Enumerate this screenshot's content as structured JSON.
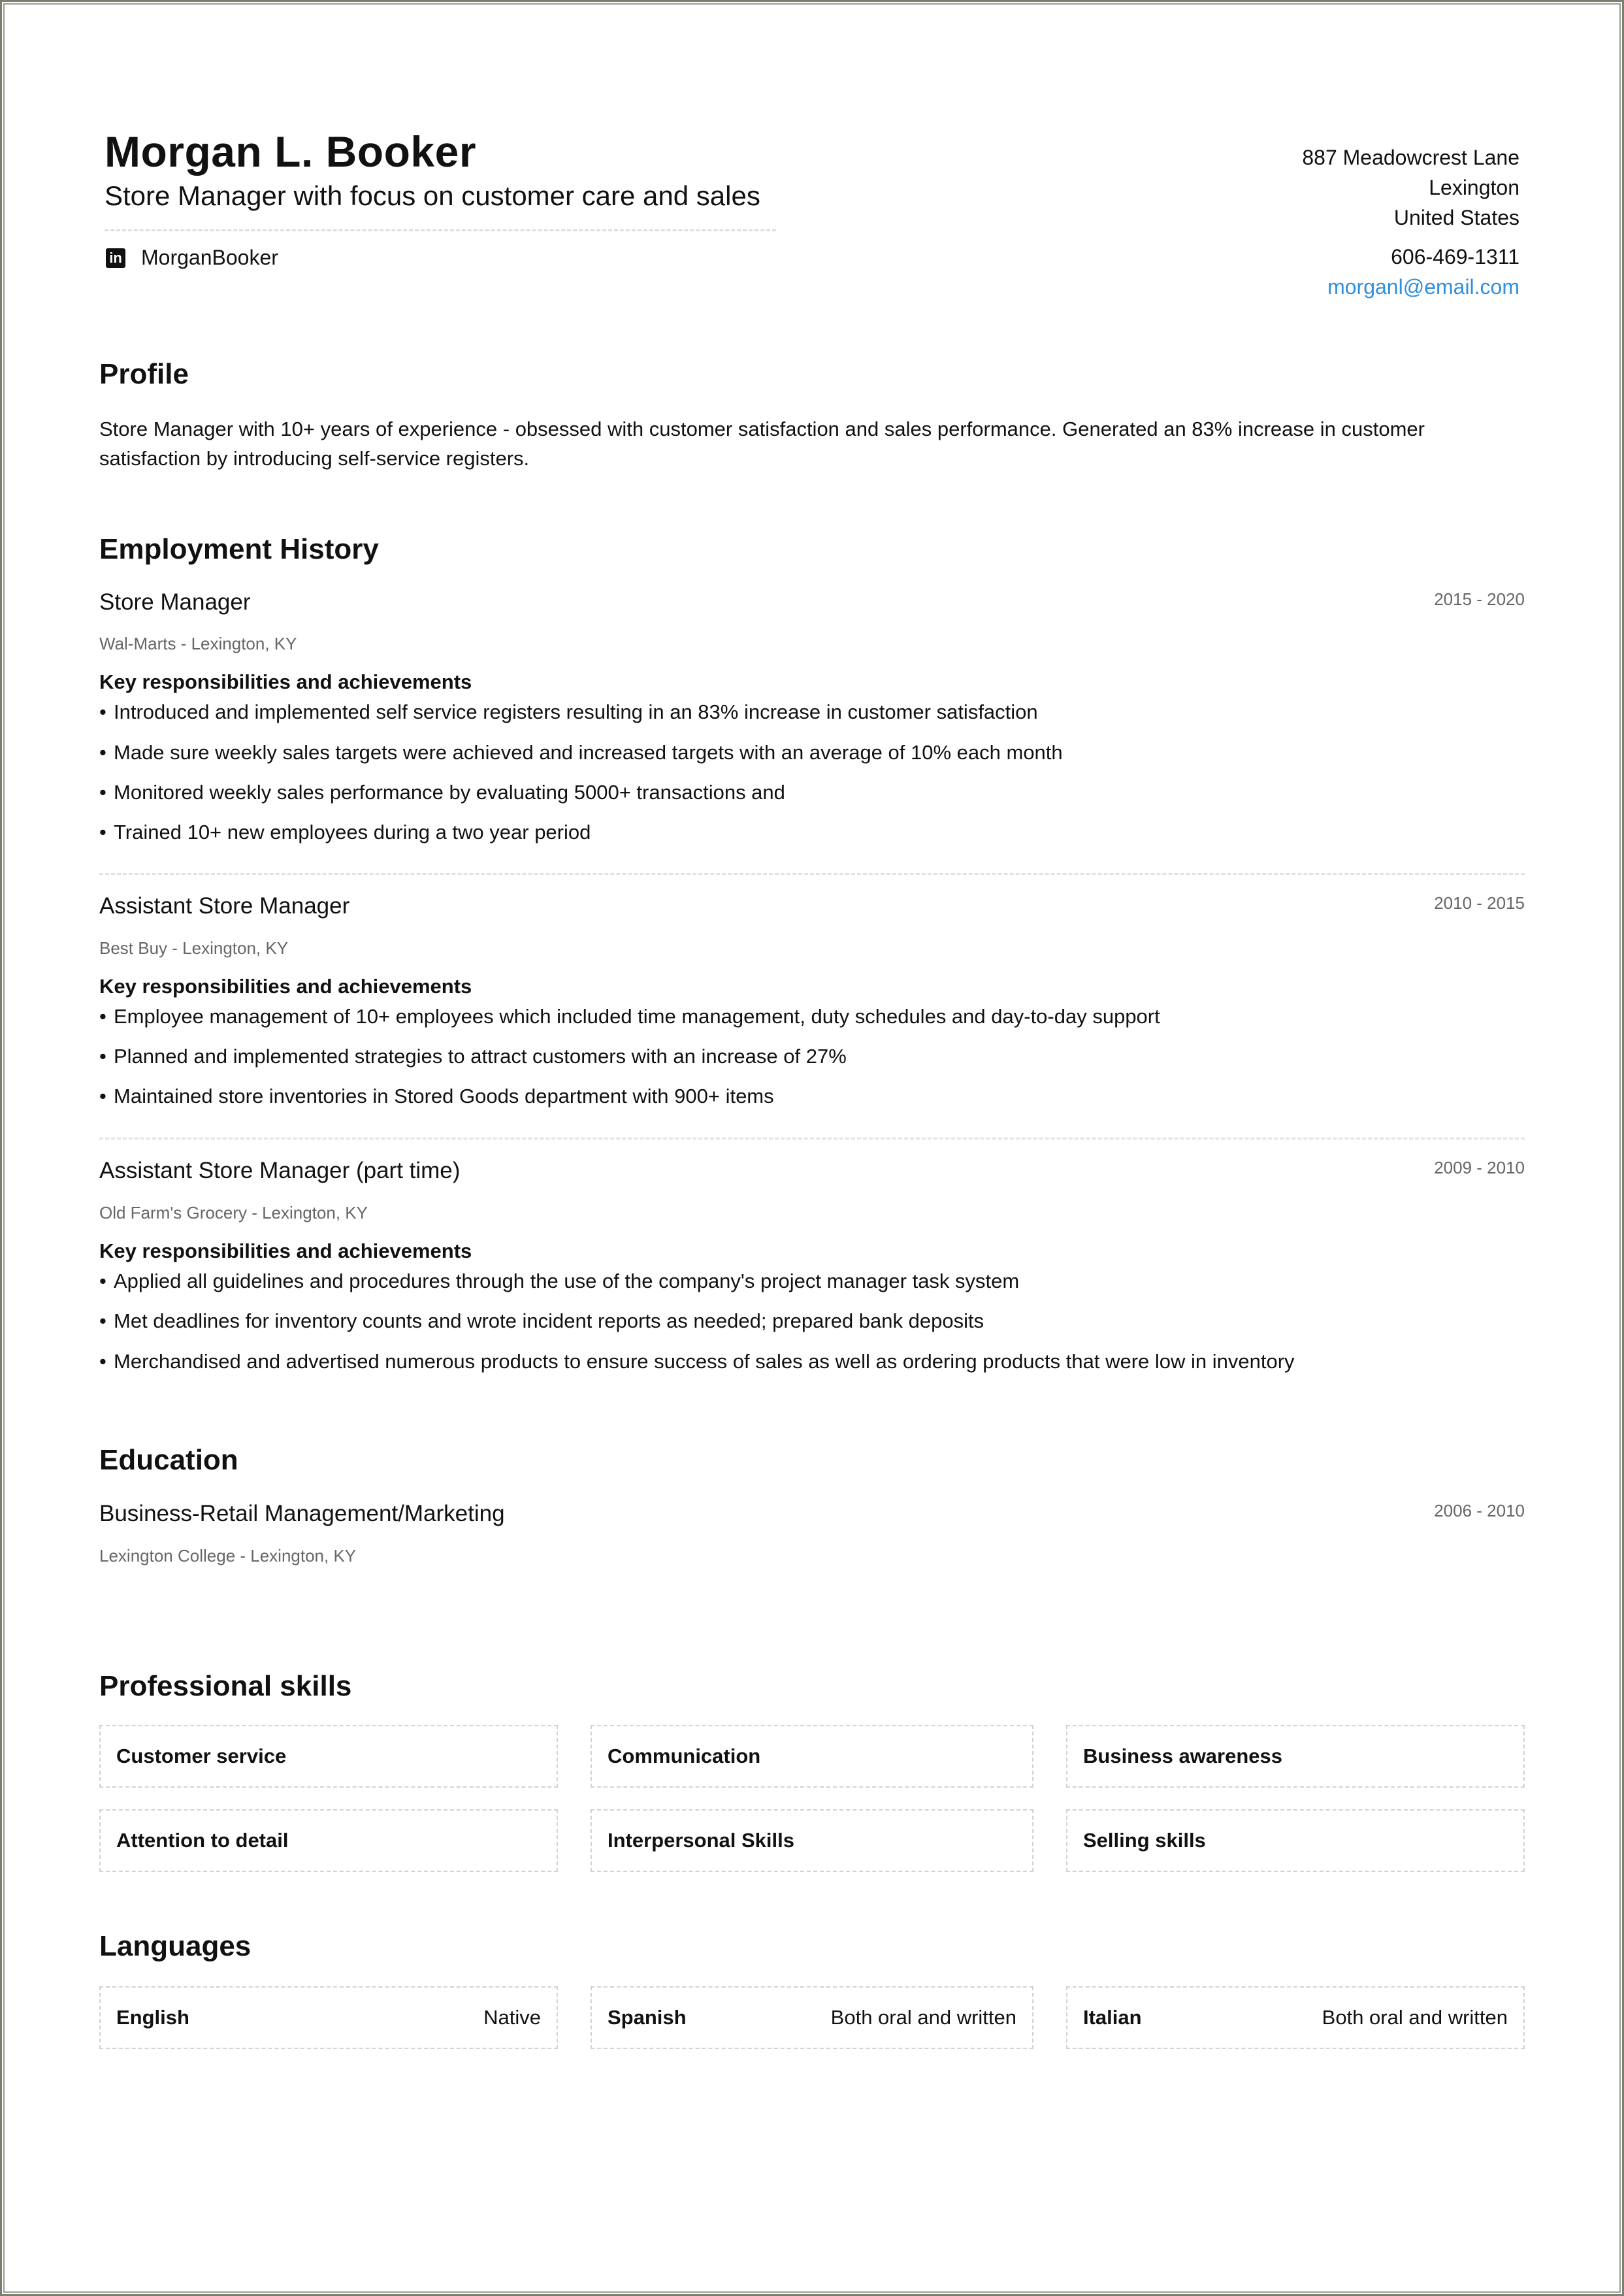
{
  "header": {
    "name": "Morgan L. Booker",
    "headline": "Store Manager with focus on customer care and sales",
    "linkedin": {
      "icon": "linkedin-icon",
      "glyph": "in",
      "handle": "MorganBooker"
    },
    "contact": {
      "address_line1": "887 Meadowcrest Lane",
      "city": "Lexington",
      "country": "United States",
      "phone": "606-469-1311",
      "email": "morganl@email.com",
      "email_color": "#2f8fdc"
    }
  },
  "profile": {
    "title": "Profile",
    "line1": "Store Manager with 10+ years of experience - obsessed with customer satisfaction and sales performance. Generated an 83% increase in customer",
    "line2": "satisfaction by introducing self-service registers."
  },
  "employment": {
    "title": "Employment History",
    "jobs": [
      {
        "title": "Store Manager",
        "dates": "2015 - 2020",
        "employer": "Wal-Marts - Lexington, KY",
        "resp_heading": "Key responsibilities and achievements",
        "bullets": [
          "Introduced and implemented self service registers resulting in an 83% increase in customer satisfaction",
          "Made sure weekly sales targets were achieved and increased targets with an average of 10% each month",
          "Monitored weekly sales performance by evaluating 5000+ transactions and",
          "Trained 10+ new employees during a two year period"
        ]
      },
      {
        "title": "Assistant Store Manager",
        "dates": "2010 - 2015",
        "employer": "Best Buy - Lexington, KY",
        "resp_heading": "Key responsibilities and achievements",
        "bullets": [
          "Employee management of 10+ employees which included time management, duty schedules and day-to-day support",
          "Planned and implemented strategies to attract customers with an increase of 27%",
          "Maintained store inventories in Stored Goods department with 900+ items"
        ]
      },
      {
        "title": "Assistant Store Manager (part time)",
        "dates": "2009 - 2010",
        "employer": "Old Farm's Grocery - Lexington, KY",
        "resp_heading": "Key responsibilities and achievements",
        "bullets": [
          "Applied all guidelines and procedures through the use of the company's project manager task system",
          "Met deadlines for inventory counts and wrote incident reports as needed; prepared bank deposits",
          "Merchandised and advertised numerous products to ensure success of sales as well as ordering products that were low in inventory"
        ]
      }
    ]
  },
  "education": {
    "title": "Education",
    "items": [
      {
        "degree": "Business-Retail Management/Marketing",
        "dates": "2006 - 2010",
        "school": "Lexington College - Lexington, KY"
      }
    ]
  },
  "skills": {
    "title": "Professional skills",
    "items": [
      "Customer service",
      "Communication",
      "Business awareness",
      "Attention to detail",
      "Interpersonal Skills",
      "Selling skills"
    ]
  },
  "languages": {
    "title": "Languages",
    "items": [
      {
        "name": "English",
        "level": "Native"
      },
      {
        "name": "Spanish",
        "level": "Both oral and written"
      },
      {
        "name": "Italian",
        "level": "Both oral and written"
      }
    ]
  },
  "bullet_glyph": "•"
}
